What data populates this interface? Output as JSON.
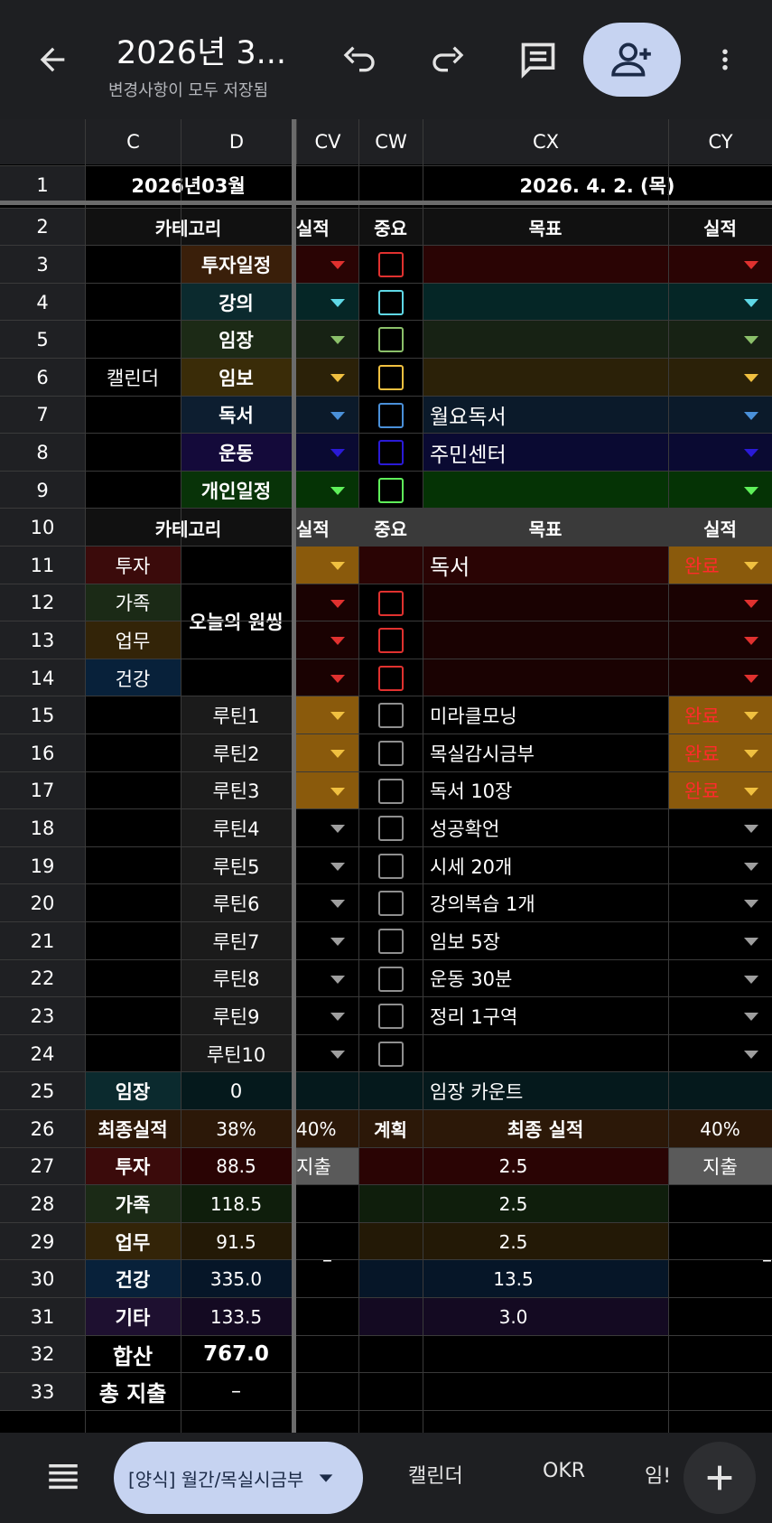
{
  "toolbar": {
    "title": "2026년 3...",
    "subtitle": "변경사항이 모두 저장됨"
  },
  "icons": {
    "back": "arrow-left-icon",
    "undo": "undo-icon",
    "redo": "redo-icon",
    "comment": "comment-icon",
    "share": "person-add-icon",
    "more": "more-vert-icon",
    "menu": "sheets-menu-icon",
    "add": "plus-icon",
    "dropdown": "triangle-down-icon"
  },
  "columns": {
    "c": "C",
    "d": "D",
    "cv": "CV",
    "cw": "CW",
    "cx": "CX",
    "cy": "CY"
  },
  "row_numbers": [
    "1",
    "2",
    "3",
    "4",
    "5",
    "6",
    "7",
    "8",
    "9",
    "10",
    "11",
    "12",
    "13",
    "14",
    "15",
    "16",
    "17",
    "18",
    "19",
    "20",
    "21",
    "22",
    "23",
    "24",
    "25",
    "26",
    "27",
    "28",
    "29",
    "30",
    "31",
    "32",
    "33"
  ],
  "sheet": {
    "r1": {
      "month": "2026년03월",
      "date": "2026. 4. 2. (목)"
    },
    "r2": {
      "category": "카테고리",
      "cv": "실적",
      "important": "중요",
      "goal": "목표",
      "result": "실적"
    },
    "calendar_label": "캘린더",
    "calendar_items": [
      "투자일정",
      "강의",
      "임장",
      "임보",
      "독서",
      "운동",
      "개인일정"
    ],
    "calendar_goals": [
      "",
      "",
      "",
      "",
      "월요독서",
      "주민센터",
      ""
    ],
    "r10": {
      "category": "카테고리",
      "cv": "실적",
      "important": "중요",
      "goal": "목표",
      "result": "실적"
    },
    "today_categories": [
      "투자",
      "가족",
      "업무",
      "건강"
    ],
    "today_label": "오늘의 원씽",
    "r11": {
      "goal": "독서",
      "result": "완료"
    },
    "routines": [
      "루틴1",
      "루틴2",
      "루틴3",
      "루틴4",
      "루틴5",
      "루틴6",
      "루틴7",
      "루틴8",
      "루틴9",
      "루틴10"
    ],
    "routine_goals": [
      "미라클모닝",
      "목실감시금부",
      "독서 10장",
      "성공확언",
      "시세 20개",
      "강의복습 1개",
      "임보 5장",
      "운동 30분",
      "정리 1구역",
      ""
    ],
    "routine_results": [
      "완료",
      "완료",
      "완료",
      "",
      "",
      "",
      "",
      "",
      "",
      ""
    ],
    "r25": {
      "label": "임장",
      "value": "0",
      "cx": "임장 카운트"
    },
    "r26": {
      "label": "최종실적",
      "d": "38%",
      "cv": "40%",
      "cw": "계획",
      "cx": "최종 실적",
      "cy": "40%"
    },
    "r27": {
      "cv": "지출",
      "cy": "지출"
    },
    "cv_dash": "–",
    "cy_dash": "–",
    "summary": [
      {
        "label": "투자",
        "d": "88.5",
        "cx": "2.5"
      },
      {
        "label": "가족",
        "d": "118.5",
        "cx": "2.5"
      },
      {
        "label": "업무",
        "d": "91.5",
        "cx": "2.5"
      },
      {
        "label": "건강",
        "d": "335.0",
        "cx": "13.5"
      },
      {
        "label": "기타",
        "d": "133.5",
        "cx": "3.0"
      }
    ],
    "r32": {
      "label": "합산",
      "value": "767.0"
    },
    "r33": {
      "label": "총 지출",
      "value": "–"
    }
  },
  "tabs": {
    "active": "[양식] 월간/목실시금부",
    "items": [
      "캘린더",
      "OKR",
      "임!"
    ]
  },
  "colors": {
    "red": "#e0312f",
    "teal": "#5fd8e6",
    "green": "#8bc06a",
    "yellow": "#f0c040",
    "blue": "#4a90d9",
    "purple": "#2a1ad6",
    "bright_green": "#5ff05a",
    "orange_cell": "#8a5a0c",
    "done_text": "#ff2b2b",
    "accent_chip": "#c6d3f1"
  }
}
